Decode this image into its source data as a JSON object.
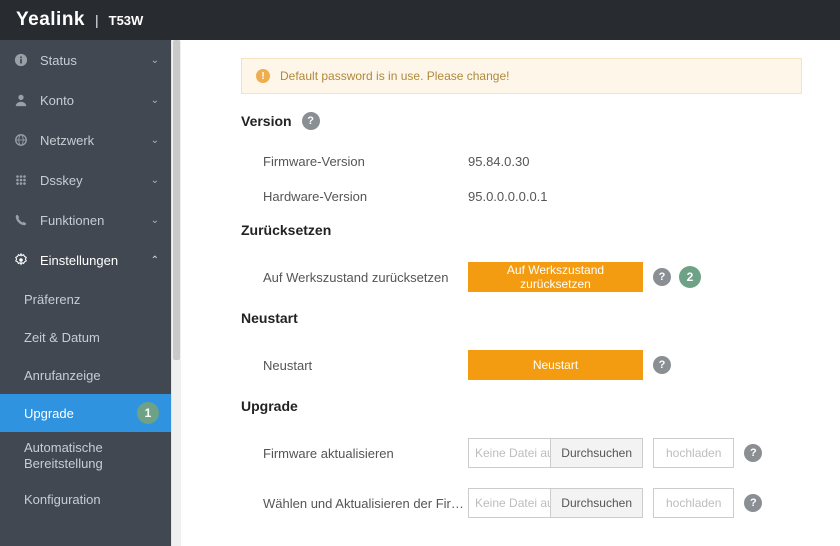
{
  "header": {
    "brand": "Yealink",
    "model": "T53W"
  },
  "alert": {
    "text": "Default password is in use. Please change!"
  },
  "nav": {
    "status": "Status",
    "konto": "Konto",
    "netzwerk": "Netzwerk",
    "dsskey": "Dsskey",
    "funktionen": "Funktionen",
    "einstellungen": "Einstellungen",
    "sub": {
      "praferenz": "Präferenz",
      "zeit": "Zeit & Datum",
      "anrufanzeige": "Anrufanzeige",
      "upgrade": "Upgrade",
      "auto": "Automatische Bereitstellung",
      "konfiguration": "Konfiguration"
    },
    "badges": {
      "upgrade": "1"
    }
  },
  "sections": {
    "version": {
      "title": "Version",
      "firmware_label": "Firmware-Version",
      "firmware_value": "95.84.0.30",
      "hardware_label": "Hardware-Version",
      "hardware_value": "95.0.0.0.0.0.1"
    },
    "reset": {
      "title": "Zurücksetzen",
      "label": "Auf Werkszustand zurücksetzen",
      "button": "Auf Werkszustand zurücksetzen",
      "badge": "2"
    },
    "restart": {
      "title": "Neustart",
      "label": "Neustart",
      "button": "Neustart"
    },
    "upgrade": {
      "title": "Upgrade",
      "firmware_label": "Firmware aktualisieren",
      "rom_label": "Wählen und Aktualisieren der Firmware de...",
      "file_placeholder": "Keine Datei ausg",
      "browse": "Durchsuchen",
      "upload": "hochladen"
    }
  }
}
